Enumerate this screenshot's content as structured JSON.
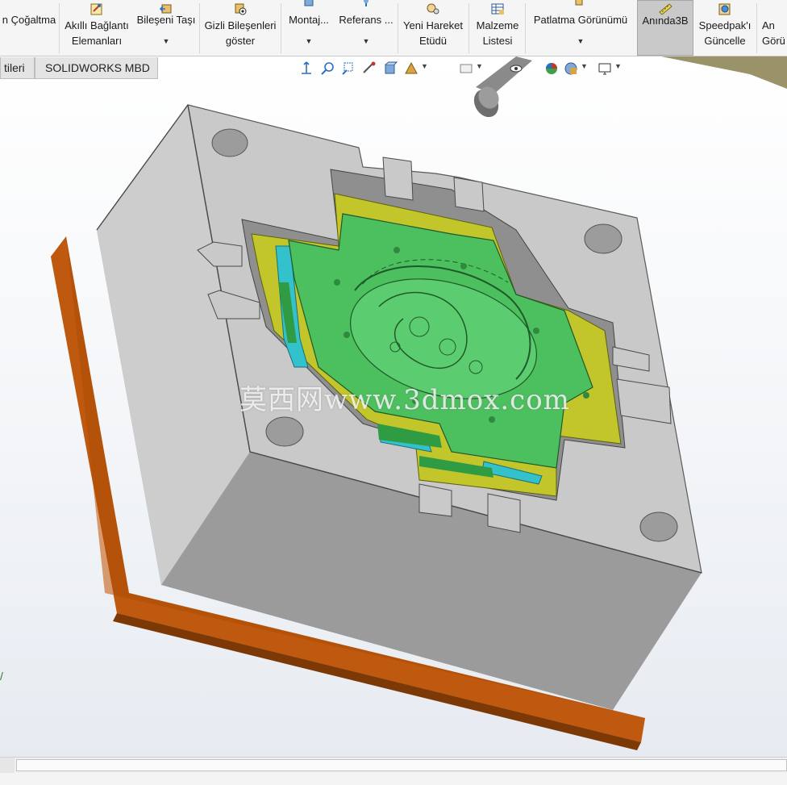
{
  "ribbon": {
    "items": [
      {
        "id": "pattern",
        "line1": "n Çoğaltma",
        "line2": ""
      },
      {
        "id": "smart_fasteners",
        "line1": "Akıllı Bağlantı",
        "line2": "Elemanları"
      },
      {
        "id": "move_component",
        "line1": "Bileşeni Taşı",
        "line2": ""
      },
      {
        "id": "show_hidden",
        "line1": "Gizli Bileşenleri",
        "line2": "göster"
      },
      {
        "id": "assembly",
        "line1": "Montaj...",
        "line2": ""
      },
      {
        "id": "reference",
        "line1": "Referans ...",
        "line2": ""
      },
      {
        "id": "new_motion",
        "line1": "Yeni Hareket",
        "line2": "Etüdü"
      },
      {
        "id": "bom",
        "line1": "Malzeme",
        "line2": "Listesi"
      },
      {
        "id": "exploded_view",
        "line1": "Patlatma Görünümü",
        "line2": ""
      },
      {
        "id": "instant3d",
        "line1": "Anında3B",
        "line2": ""
      },
      {
        "id": "speedpak",
        "line1": "Speedpak'ı",
        "line2": "Güncelle"
      },
      {
        "id": "snapshot",
        "line1": "An",
        "line2": "Görü"
      }
    ],
    "active_item": "Anında3B"
  },
  "tabs": [
    {
      "label": "tileri"
    },
    {
      "label": "SOLIDWORKS MBD"
    }
  ],
  "heads_up_icons": [
    "zoom-to-fit-icon",
    "zoom-area-icon",
    "previous-view-icon",
    "section-view-icon",
    "view-orientation-icon",
    "display-style-icon",
    "hide-show-icon",
    "edit-appearance-icon",
    "apply-scene-icon",
    "view-settings-icon",
    "monitor-icon"
  ],
  "viewport": {
    "watermark": "莫西网www.3dmox.com",
    "triad_fragment": "/"
  },
  "colors": {
    "ribbon_bg": "#f5f5f5",
    "active_button": "#c9c9c9",
    "mold_plate": "#c8c8c8",
    "mold_plate_front": "#9a9a9a",
    "base_plate": "#b5520a",
    "insert_green": "#4cbf5f",
    "insert_yellow": "#c2c62b",
    "slider_cyan": "#33c1cc"
  }
}
